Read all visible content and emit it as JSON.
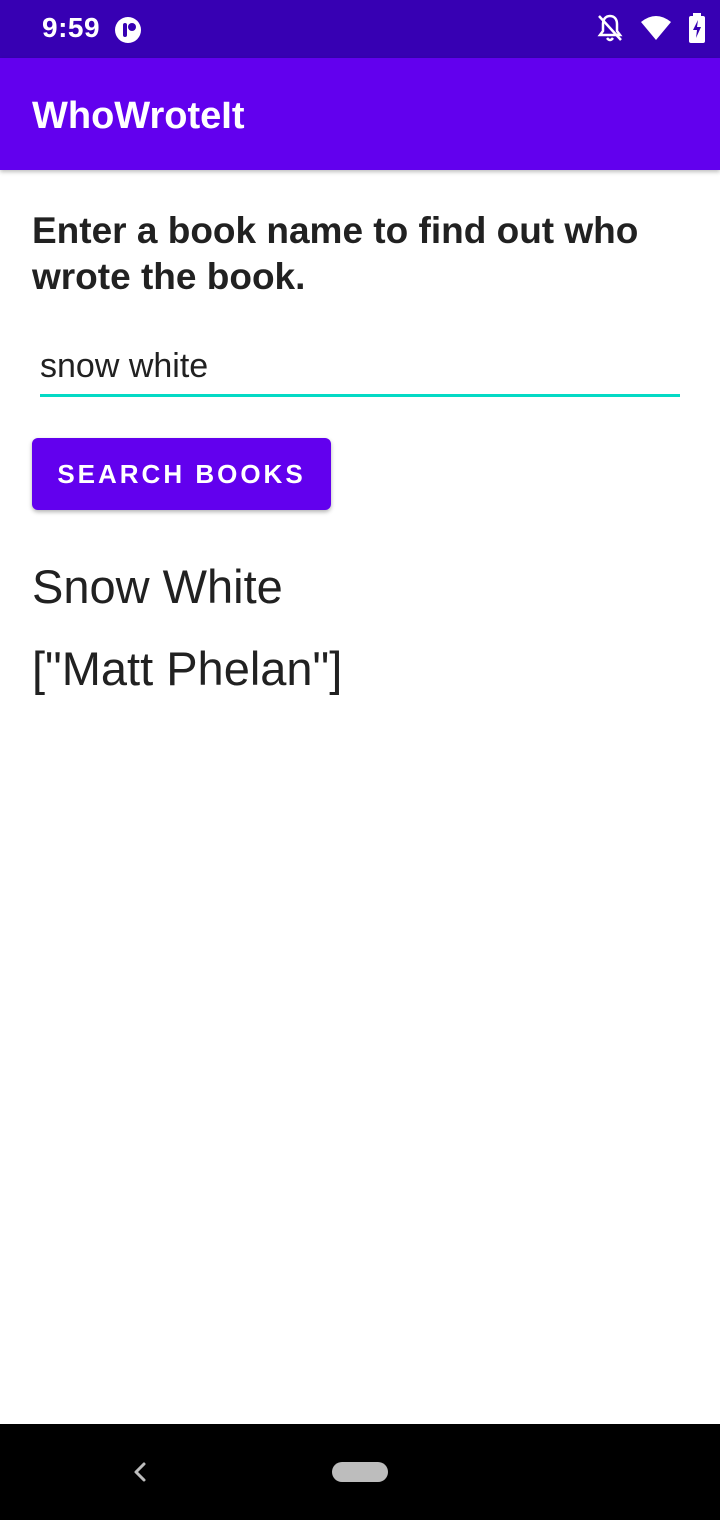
{
  "status_bar": {
    "time": "9:59",
    "icons": [
      "app-notification-icon",
      "notifications-off-icon",
      "wifi-icon",
      "battery-charging-icon"
    ]
  },
  "app_bar": {
    "title": "WhoWroteIt"
  },
  "main": {
    "instructions": "Enter a book name to find out who wrote the book.",
    "book_input": {
      "value": "snow white"
    },
    "search_button_label": "SEARCH BOOKS",
    "result": {
      "title": "Snow White",
      "authors": "[\"Matt Phelan\"]"
    }
  },
  "nav_bar": {
    "icons": [
      "back-icon",
      "home-pill"
    ]
  },
  "colors": {
    "status_bar": "#3700b3",
    "primary": "#6200ee",
    "accent": "#03dac5"
  }
}
